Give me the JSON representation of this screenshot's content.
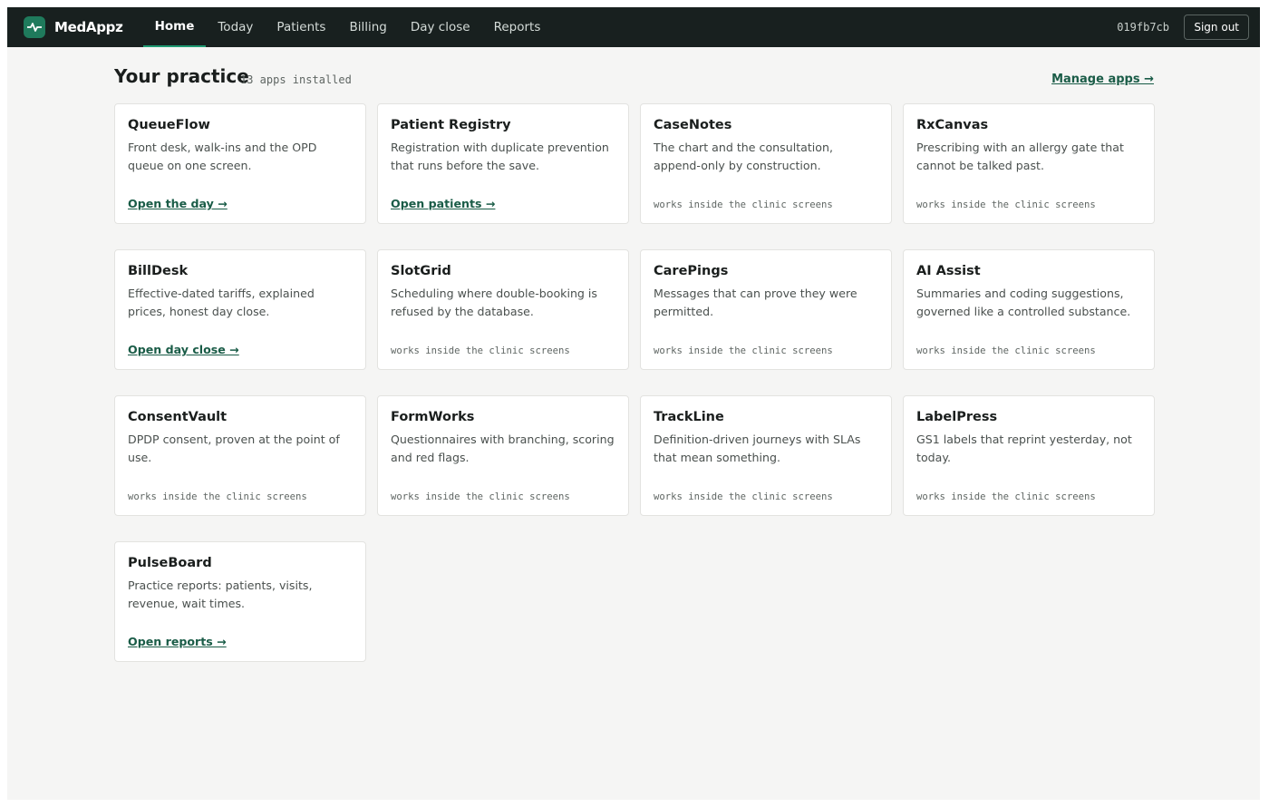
{
  "app": {
    "name": "MedAppz"
  },
  "nav": {
    "items": [
      "Home",
      "Today",
      "Patients",
      "Billing",
      "Day close",
      "Reports"
    ],
    "active_index": 0
  },
  "session": {
    "id": "019fb7cb",
    "sign_out_label": "Sign out"
  },
  "header": {
    "title": "Your practice",
    "subtitle": "13 apps installed",
    "manage_link": "Manage apps →"
  },
  "apps": [
    {
      "name": "QueueFlow",
      "description": "Front desk, walk-ins and the OPD queue on one screen.",
      "action": "Open the day →"
    },
    {
      "name": "Patient Registry",
      "description": "Registration with duplicate prevention that runs before the save.",
      "action": "Open patients →"
    },
    {
      "name": "CaseNotes",
      "description": "The chart and the consultation, append-only by construction.",
      "note": "works inside the clinic screens"
    },
    {
      "name": "RxCanvas",
      "description": "Prescribing with an allergy gate that cannot be talked past.",
      "note": "works inside the clinic screens"
    },
    {
      "name": "BillDesk",
      "description": "Effective-dated tariffs, explained prices, honest day close.",
      "action": "Open day close →"
    },
    {
      "name": "SlotGrid",
      "description": "Scheduling where double-booking is refused by the database.",
      "note": "works inside the clinic screens"
    },
    {
      "name": "CarePings",
      "description": "Messages that can prove they were permitted.",
      "note": "works inside the clinic screens"
    },
    {
      "name": "AI Assist",
      "description": "Summaries and coding suggestions, governed like a controlled substance.",
      "note": "works inside the clinic screens"
    },
    {
      "name": "ConsentVault",
      "description": "DPDP consent, proven at the point of use.",
      "note": "works inside the clinic screens"
    },
    {
      "name": "FormWorks",
      "description": "Questionnaires with branching, scoring and red flags.",
      "note": "works inside the clinic screens"
    },
    {
      "name": "TrackLine",
      "description": "Definition-driven journeys with SLAs that mean something.",
      "note": "works inside the clinic screens"
    },
    {
      "name": "LabelPress",
      "description": "GS1 labels that reprint yesterday, not today.",
      "note": "works inside the clinic screens"
    },
    {
      "name": "PulseBoard",
      "description": "Practice reports: patients, visits, revenue, wait times.",
      "action": "Open reports →"
    }
  ],
  "icons": {
    "logo": "pulse-icon"
  },
  "colors": {
    "topbar": "#18201f",
    "accent": "#1f7a5c",
    "link": "#1a5c47",
    "background": "#f5f5f4"
  }
}
